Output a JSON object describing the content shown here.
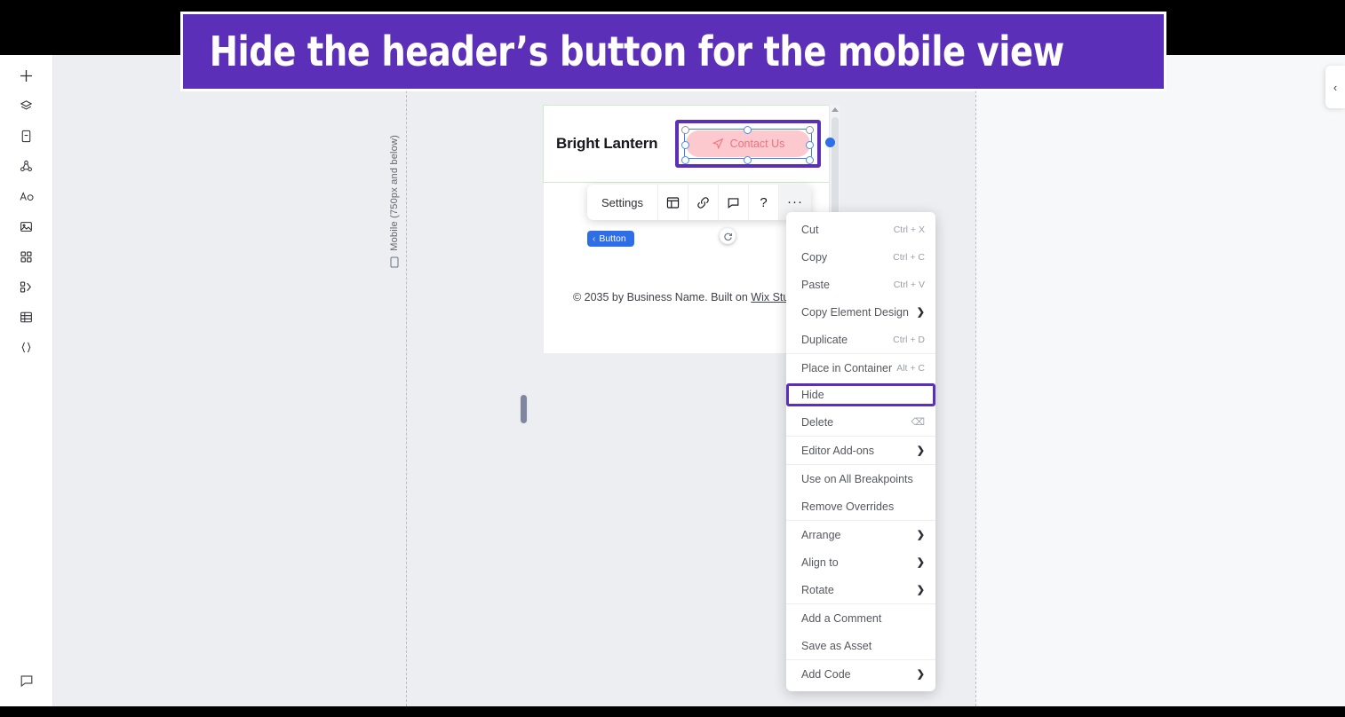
{
  "banner": {
    "text": "Hide the header’s button for the mobile view",
    "bg_color": "#5B2FB8"
  },
  "sidebar": {
    "items": [
      {
        "name": "add-elements",
        "icon": "plus-icon"
      },
      {
        "name": "layers",
        "icon": "layers-icon"
      },
      {
        "name": "pages",
        "icon": "pages-icon"
      },
      {
        "name": "site-structure",
        "icon": "site-structure-icon"
      },
      {
        "name": "theme",
        "icon": "theme-icon"
      },
      {
        "name": "media",
        "icon": "image-icon"
      },
      {
        "name": "apps",
        "icon": "apps-grid-icon"
      },
      {
        "name": "dev-tools",
        "icon": "dev-tools-icon"
      },
      {
        "name": "cms",
        "icon": "table-icon"
      },
      {
        "name": "code",
        "icon": "curly-braces-icon"
      }
    ],
    "bottom": {
      "name": "comments",
      "icon": "comment-icon"
    }
  },
  "canvas": {
    "breakpoint_label": "Mobile (750px and below)",
    "breakpoint_icon": "mobile-icon"
  },
  "site": {
    "brand": "Bright Lantern",
    "header_button": {
      "label": "Contact Us",
      "icon": "send-icon",
      "bg_color": "#FCC9CE",
      "text_color": "#F2717F"
    },
    "footer": {
      "prefix": "© 2035 by Business Name. Built on ",
      "link": "Wix Studio"
    }
  },
  "toolbar": {
    "settings_label": "Settings",
    "icons": [
      {
        "name": "layout-icon"
      },
      {
        "name": "link-icon"
      },
      {
        "name": "comment-icon"
      },
      {
        "name": "help-icon",
        "glyph": "?"
      },
      {
        "name": "more-icon",
        "glyph": "···"
      }
    ]
  },
  "element_tag": {
    "chevron": "‹",
    "label": "Button"
  },
  "context_menu": {
    "groups": [
      {
        "items": [
          {
            "label": "Cut",
            "shortcut": "Ctrl + X"
          },
          {
            "label": "Copy",
            "shortcut": "Ctrl + C"
          },
          {
            "label": "Paste",
            "shortcut": "Ctrl + V"
          },
          {
            "label": "Copy Element Design",
            "submenu": true
          },
          {
            "label": "Duplicate",
            "shortcut": "Ctrl + D"
          }
        ]
      },
      {
        "items": [
          {
            "label": "Place in Container",
            "shortcut": "Alt + C"
          },
          {
            "label": "Hide",
            "highlighted": true
          },
          {
            "label": "Delete",
            "backspace": true
          }
        ]
      },
      {
        "items": [
          {
            "label": "Editor Add-ons",
            "submenu": true
          }
        ]
      },
      {
        "items": [
          {
            "label": "Use on All Breakpoints"
          },
          {
            "label": "Remove Overrides"
          }
        ]
      },
      {
        "items": [
          {
            "label": "Arrange",
            "submenu": true
          },
          {
            "label": "Align to",
            "submenu": true
          },
          {
            "label": "Rotate",
            "submenu": true
          }
        ]
      },
      {
        "items": [
          {
            "label": "Add a Comment"
          },
          {
            "label": "Save as Asset"
          }
        ]
      },
      {
        "items": [
          {
            "label": "Add Code",
            "submenu": true
          }
        ]
      }
    ]
  },
  "right_panel_tab": {
    "chevron": "‹"
  }
}
